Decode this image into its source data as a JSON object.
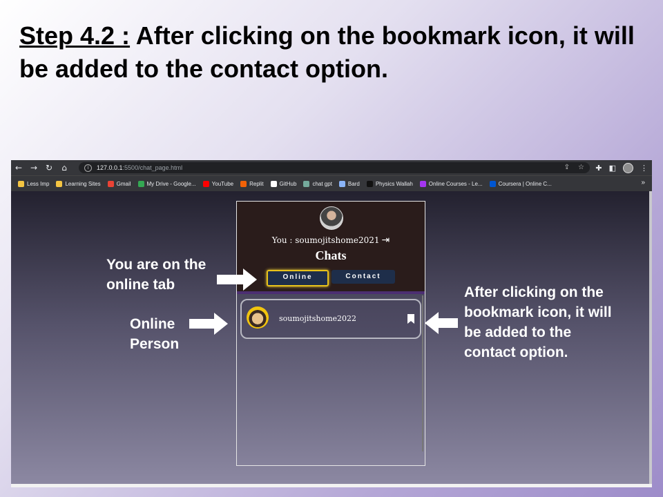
{
  "slide": {
    "step_label": "Step 4.2 :",
    "title_text": "After clicking on the bookmark icon, it will be added to the contact option."
  },
  "browser": {
    "nav_icons": [
      "arrow-left-icon",
      "arrow-right-icon",
      "reload-icon",
      "home-icon"
    ],
    "url_host": "127.0.0.1",
    "url_rest": ":5500/chat_page.html",
    "bookmarks": [
      {
        "label": "Less Imp",
        "icon": "folder-icon",
        "color": "#f4c542"
      },
      {
        "label": "Learning Sites",
        "icon": "folder-icon",
        "color": "#f4c542"
      },
      {
        "label": "Gmail",
        "icon": "gmail-icon",
        "color": "#ea4335"
      },
      {
        "label": "My Drive - Google...",
        "icon": "drive-icon",
        "color": "#34a853"
      },
      {
        "label": "YouTube",
        "icon": "youtube-icon",
        "color": "#ff0000"
      },
      {
        "label": "Replit",
        "icon": "replit-icon",
        "color": "#f26207"
      },
      {
        "label": "GitHub",
        "icon": "github-icon",
        "color": "#ffffff"
      },
      {
        "label": "chat gpt",
        "icon": "chatgpt-icon",
        "color": "#74aa9c"
      },
      {
        "label": "Bard",
        "icon": "bard-icon",
        "color": "#8ab4f8"
      },
      {
        "label": "Physics Wallah",
        "icon": "pw-icon",
        "color": "#111111"
      },
      {
        "label": "Online Courses - Le...",
        "icon": "udemy-icon",
        "color": "#a435f0"
      },
      {
        "label": "Coursera | Online C...",
        "icon": "coursera-icon",
        "color": "#0056d2"
      }
    ],
    "overflow": "»"
  },
  "app": {
    "you_line": "You : soumojitshome2021",
    "chats_title": "Chats",
    "tabs": {
      "online": "Online",
      "contact": "Contact"
    },
    "user": {
      "name": "soumojitshome2022"
    },
    "colors": {
      "header_bg": "#2a1c1b",
      "tab_bg": "#1e2e4a",
      "active_border": "#e8c21a"
    }
  },
  "annotations": {
    "online_tab_note": [
      "You are on the",
      "online tab"
    ],
    "online_person_note": [
      "Online",
      "Person"
    ],
    "bookmark_note": [
      "After clicking on the",
      "bookmark icon, it will",
      "be added to the",
      "contact option."
    ]
  }
}
